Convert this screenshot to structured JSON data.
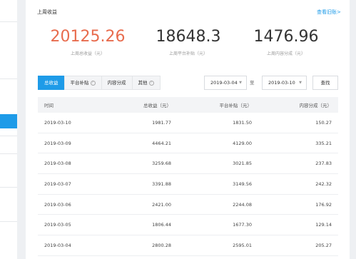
{
  "section": {
    "title": "上周收益",
    "history_link": "查看旧账>"
  },
  "stats": [
    {
      "value": "20125.26",
      "label": "上周总收益（元）",
      "color": "#e86c4e"
    },
    {
      "value": "18648.3",
      "label": "上周平台补贴（元）",
      "color": "#333333"
    },
    {
      "value": "1476.96",
      "label": "上周内容分成（元）",
      "color": "#333333"
    }
  ],
  "tabs": [
    {
      "label": "总收益",
      "active": true,
      "help": false
    },
    {
      "label": "平台补贴",
      "active": false,
      "help": true
    },
    {
      "label": "内容分成",
      "active": false,
      "help": false
    },
    {
      "label": "其他",
      "active": false,
      "help": true
    }
  ],
  "date_range": {
    "start": "2019-03-04",
    "separator": "至",
    "end": "2019-03-10",
    "query_label": "查找"
  },
  "table": {
    "headers": [
      "时间",
      "总收益（元）",
      "平台补贴（元）",
      "内容分成（元）"
    ],
    "rows": [
      [
        "2019-03-10",
        "1981.77",
        "1831.50",
        "150.27"
      ],
      [
        "2019-03-09",
        "4464.21",
        "4129.00",
        "335.21"
      ],
      [
        "2019-03-08",
        "3259.68",
        "3021.85",
        "237.83"
      ],
      [
        "2019-03-07",
        "3391.88",
        "3149.56",
        "242.32"
      ],
      [
        "2019-03-06",
        "2421.00",
        "2244.08",
        "176.92"
      ],
      [
        "2019-03-05",
        "1806.44",
        "1677.30",
        "129.14"
      ],
      [
        "2019-03-04",
        "2800.28",
        "2595.01",
        "205.27"
      ]
    ]
  },
  "colors": {
    "accent": "#1e9be8",
    "highlight_value": "#e86c4e"
  }
}
